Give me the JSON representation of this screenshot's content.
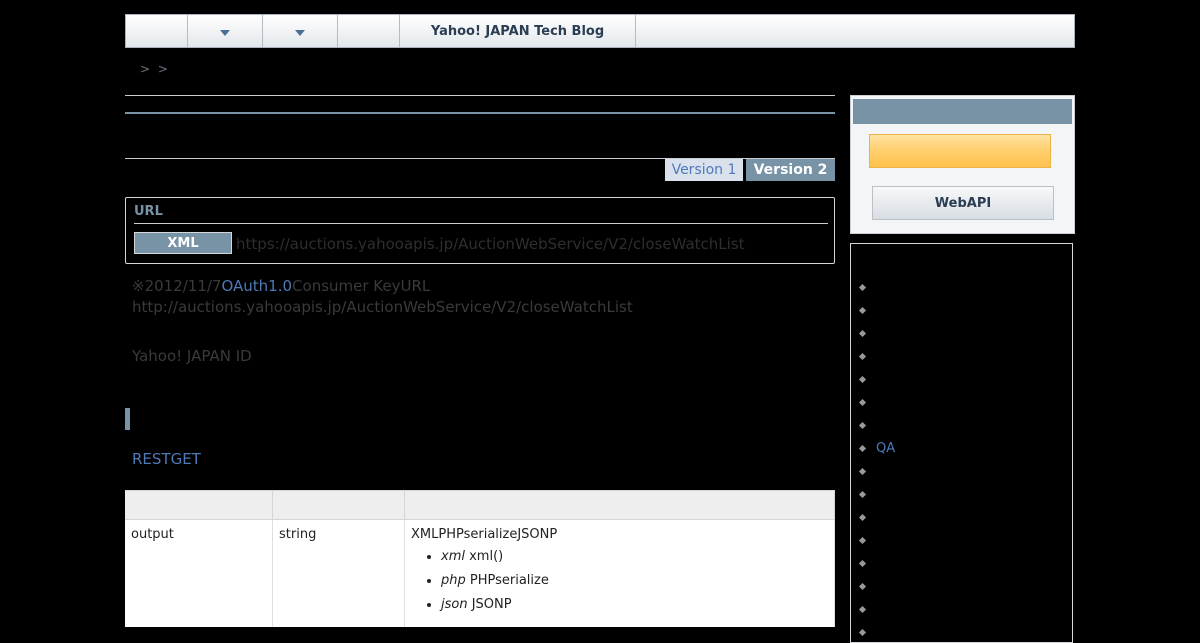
{
  "nav": {
    "site_title": "Yahoo! JAPAN Tech Blog",
    "breadcrumb": "> >"
  },
  "version_tabs": [
    "Version 1",
    "Version 2"
  ],
  "url_box": {
    "label": "URL",
    "badge": "XML",
    "url": "https://auctions.yahooapis.jp/AuctionWebService/V2/closeWatchList"
  },
  "notice": {
    "date_prefix": "※2012/11/7",
    "oauth_link": "OAuth1.0",
    "after_link": "Consumer KeyURL",
    "old_url": "http://auctions.yahooapis.jp/AuctionWebService/V2/closeWatchList",
    "id_text": "Yahoo! JAPAN ID"
  },
  "request": {
    "method_link": "RESTGET"
  },
  "table": {
    "rows": [
      {
        "name": "output",
        "type": "string",
        "desc": "XMLPHPserializeJSONP",
        "options": [
          {
            "key": "xml",
            "text": "xml()"
          },
          {
            "key": "php",
            "text": "PHPserialize"
          },
          {
            "key": "json",
            "text": "JSONP"
          }
        ]
      }
    ]
  },
  "sidebar": {
    "webapi_button": "WebAPI",
    "qa_label": "QA"
  },
  "colors": {
    "accent": "#7892a6",
    "link": "#4e79b8",
    "background": "#000000"
  }
}
